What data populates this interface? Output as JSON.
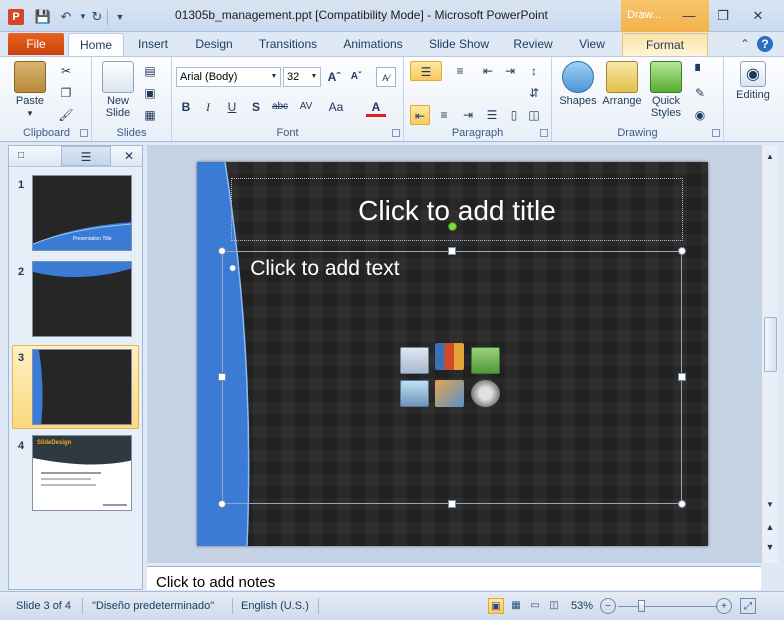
{
  "window": {
    "title": "01305b_management.ppt [Compatibility Mode]  -  Microsoft PowerPoint",
    "app_icon_letter": "P",
    "contextual_tab_group": "Draw...",
    "qat": {
      "save_icon": "save-icon",
      "undo_icon": "undo-icon",
      "redo_icon": "redo-icon"
    }
  },
  "tabs": {
    "file": "File",
    "items": [
      "Home",
      "Insert",
      "Design",
      "Transitions",
      "Animations",
      "Slide Show",
      "Review",
      "View",
      "Format"
    ]
  },
  "ribbon": {
    "clipboard": {
      "label": "Clipboard",
      "paste": "Paste"
    },
    "slides": {
      "label": "Slides",
      "new_slide": "New Slide"
    },
    "font": {
      "label": "Font",
      "font_name": "Arial (Body)",
      "font_size": "32"
    },
    "paragraph": {
      "label": "Paragraph"
    },
    "drawing": {
      "label": "Drawing",
      "shapes": "Shapes",
      "arrange": "Arrange",
      "quick_styles": "Quick Styles"
    },
    "editing": {
      "label": "Editing"
    }
  },
  "thumbnails": {
    "numbers": [
      "1",
      "2",
      "3",
      "4"
    ],
    "slide1_caption": "Presentation    Title",
    "slide4_title": "SlideDesign"
  },
  "slide": {
    "title_placeholder": "Click to add title",
    "body_placeholder": "Click to add text",
    "bullet": "•"
  },
  "notes": {
    "placeholder": "Click to add notes"
  },
  "status": {
    "slide_info": "Slide 3 of 4",
    "theme": "\"Diseño predeterminado\"",
    "language": "English (U.S.)",
    "zoom": "53%"
  },
  "colors": {
    "accent": "#3a7bd5",
    "file_tab": "#d3501a",
    "slide_bg": "#262626"
  }
}
